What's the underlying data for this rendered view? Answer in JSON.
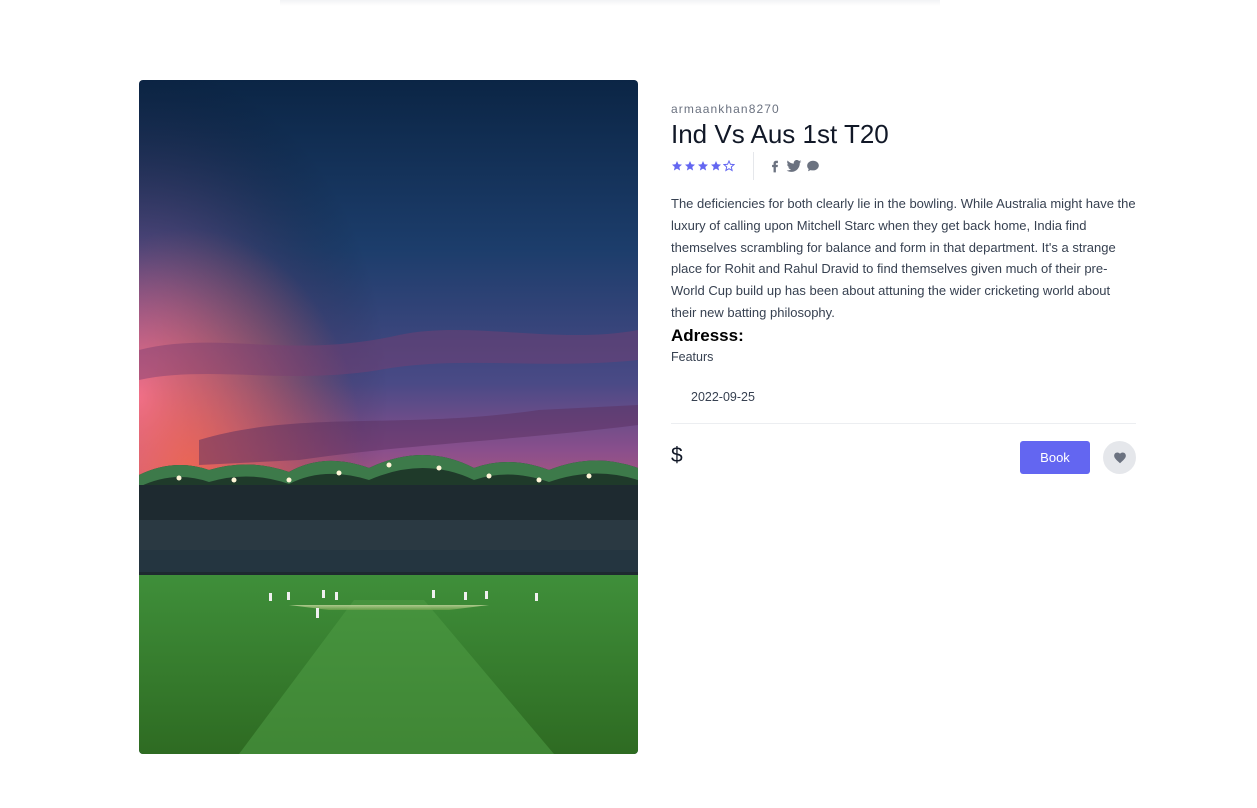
{
  "product": {
    "author": "armaankhan8270",
    "title": "Ind Vs Aus 1st T20",
    "rating": 4,
    "rating_max": 5,
    "description": "The deficiencies for both clearly lie in the bowling. While Australia might have the luxury of calling upon Mitchell Starc when they get back home, India find themselves scrambling for balance and form in that department. It's a strange place for Rohit and Rahul Dravid to find themselves given much of their pre-World Cup build up has been about attuning the wider cricketing world about their new batting philosophy.",
    "address_heading": "Adresss:",
    "features": "Featurs",
    "date": "2022-09-25",
    "price": "$"
  },
  "social": {
    "icons": [
      "facebook-icon",
      "twitter-icon",
      "chat-icon"
    ]
  },
  "actions": {
    "book_label": "Book",
    "wishlist_icon": "heart-icon"
  },
  "colors": {
    "accent": "#6366f1",
    "star": "#6366f1",
    "text": "#111827",
    "muted": "#6b7280"
  }
}
